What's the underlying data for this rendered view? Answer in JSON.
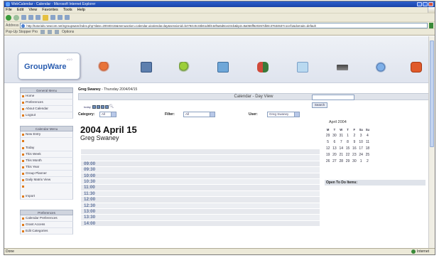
{
  "browser": {
    "title": "WebCalendar - Calendar - Microsoft Internet Explorer",
    "menu": [
      "File",
      "Edit",
      "View",
      "Favorites",
      "Tools",
      "Help"
    ],
    "address_label": "Address",
    "address": "http://tutorials.newcom.net/egroupware/index.php?date=20040415&menuaction=calendar.uicalendar.day&sessionid=b4794c0c33b61d6f44ef6a5d6ce23cb&kp3=8a056ff620267db0c37634637c1cef1&domain=default",
    "links_label": "Pop-Up Stopper Pro",
    "links_options": "Options",
    "status_left": "Done",
    "status_zone": "Internet"
  },
  "app": {
    "logo": "GroupWare",
    "logo_version": "v1.0",
    "nav_icons": [
      "home-icon",
      "calendar-icon",
      "infolog-icon",
      "addressbook-icon",
      "users-icon",
      "projects-icon",
      "preferences-icon",
      "help-icon",
      "logout-icon"
    ]
  },
  "sidebar": {
    "general_head": "General Menu",
    "general_items": [
      "Home",
      "Preferences",
      "About Calendar",
      "Logout"
    ],
    "calendar_head": "Calendar Menu",
    "calendar_items": [
      "New Entry",
      "Today",
      "This Week",
      "This Month",
      "This Year",
      "Group Planner",
      "Daily Matrix View",
      "Import"
    ],
    "prefs_head": "Preferences",
    "prefs_items": [
      "Calendar Preferences",
      "Grant Access",
      "Edit Categories"
    ]
  },
  "main": {
    "user_name": "Greg Swaney",
    "crumb_date": " - Thursday 2004/04/15",
    "view_title": "Calendar - Day View",
    "today_label": "today",
    "category_label": "Category:",
    "category_value": "All",
    "filter_label": "Filter:",
    "filter_value": "All",
    "user_label": "User:",
    "user_value": "Greg Swaney",
    "search_button": "Search",
    "date_heading": "2004 April 15",
    "date_user": "Greg Swaney",
    "time_slots": [
      "",
      "",
      "09:00",
      "09:30",
      "10:00",
      "10:30",
      "11:00",
      "11:30",
      "12:00",
      "12:30",
      "13:00",
      "13:30",
      "14:00"
    ]
  },
  "mini_calendar": {
    "title": "April 2004",
    "days": [
      "M",
      "T",
      "W",
      "T",
      "F",
      "Sa",
      "Su"
    ],
    "weeks": [
      [
        "29",
        "30",
        "31",
        "1",
        "2",
        "3",
        "4"
      ],
      [
        "5",
        "6",
        "7",
        "8",
        "9",
        "10",
        "11"
      ],
      [
        "12",
        "13",
        "14",
        "15",
        "16",
        "17",
        "18"
      ],
      [
        "19",
        "20",
        "21",
        "22",
        "23",
        "24",
        "25"
      ],
      [
        "26",
        "27",
        "28",
        "29",
        "30",
        "1",
        "2"
      ]
    ],
    "todo_label": "Open To Do Items:"
  }
}
